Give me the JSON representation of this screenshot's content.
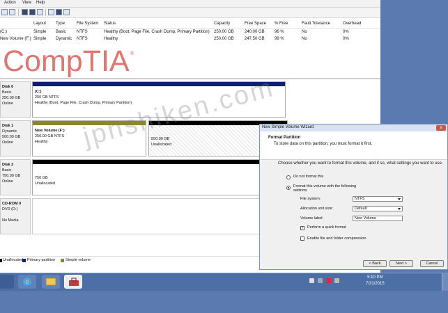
{
  "menu": [
    "Action",
    "View",
    "Help"
  ],
  "volume_table": {
    "headers": [
      "Layout",
      "Type",
      "File System",
      "Status",
      "Capacity",
      "Free Space",
      "% Free",
      "Fault Tolerance",
      "Overhead"
    ],
    "rows": [
      {
        "name": "(C:)",
        "layout": "Simple",
        "type": "Basic",
        "fs": "NTFS",
        "status": "Healthy (Boot, Page File, Crash Dump, Primary Partition)",
        "capacity": "250.00 GB",
        "free": "240.00 GB",
        "pct": "96 %",
        "fault": "No",
        "overhead": "0%"
      },
      {
        "name": "New Volume (F:)",
        "layout": "Simple",
        "type": "Dynamic",
        "fs": "NTFS",
        "status": "Healthy",
        "capacity": "250.00 GB",
        "free": "247.50 GB",
        "pct": "99 %",
        "fault": "No",
        "overhead": "0%"
      }
    ]
  },
  "logo": {
    "text": "CompTIA",
    "reg": "®"
  },
  "disks": [
    {
      "label": "Disk 0",
      "type": "Basic",
      "size": "250.00 GB",
      "status": "Online"
    },
    {
      "label": "Disk 1",
      "type": "Dynamic",
      "size": "500.00 GB",
      "status": "Online"
    },
    {
      "label": "Disk 2",
      "type": "Basic",
      "size": "750.00 GB",
      "status": "Online"
    },
    {
      "label": "CD-ROM 0",
      "type": "DVD (D:)",
      "size": "",
      "status": "No Media"
    }
  ],
  "partitions": {
    "c": {
      "name": "(C:)",
      "size": "250 GB NTFS",
      "status": "Healthy (Boot, Page File, Crash Dump, Primary Partition)"
    },
    "f": {
      "name": "New Volume (F:)",
      "size": "250.00 GB NTFS",
      "status": "Healthy"
    },
    "d1_unalloc": {
      "size": "500.00 GB",
      "status": "Unallocated"
    },
    "d2_unalloc": {
      "size": "750 GB",
      "status": "Unallocated"
    }
  },
  "legend": [
    "Unallocated",
    "Primary partition",
    "Simple volume"
  ],
  "colors": {
    "primary_partition": "#0b1f7a",
    "simple_volume": "#8a8a20",
    "unallocated": "#000000",
    "logo": "#e2756f",
    "taskbar": "#4c6fa6"
  },
  "wizard": {
    "title": "New Simple Volume Wizard",
    "close": "x",
    "heading": "Format Partition",
    "subheading": "To store data on this partition, you must format it first.",
    "question": "Choose whether you want to format this volume, and if so, what settings you want to use.",
    "opt_no_format": "Do not format this volume",
    "opt_format": "Format this volume with the following settings:",
    "fs_label": "File system:",
    "fs_value": "NTFS",
    "aus_label": "Allocation unit size:",
    "aus_value": "Default",
    "vol_label": "Volume label:",
    "vol_value": "New Volume",
    "quick_format": "Perform a quick format",
    "compression": "Enable file and folder compression",
    "back": "< Back",
    "next": "Next >",
    "cancel": "Cancel"
  },
  "taskbar": {
    "time": "5:10 PM",
    "date": "7/31/2015"
  },
  "watermark": "jpnshiken.com"
}
